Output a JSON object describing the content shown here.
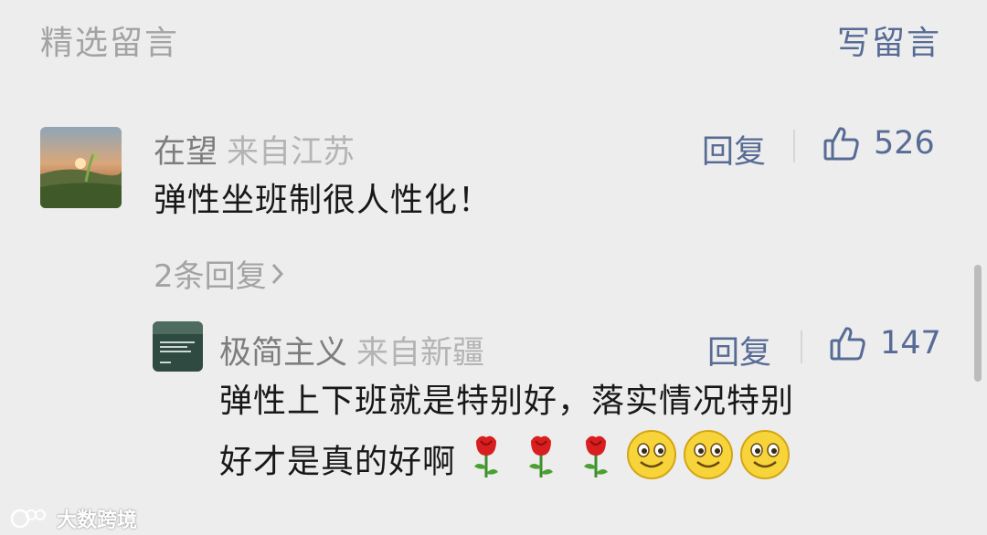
{
  "header": {
    "title": "精选留言",
    "write_label": "写留言"
  },
  "comments": [
    {
      "user": "在望",
      "location": "来自江苏",
      "text": "弹性坐班制很人性化！",
      "reply_label": "回复",
      "likes": "526",
      "more_replies": "2条回复"
    }
  ],
  "replies": [
    {
      "user": "极简主义",
      "location": "来自新疆",
      "text_line1": "弹性上下班就是特别好，落实情况特别",
      "text_line2": "好才是真的好啊",
      "emojis": [
        "rose-icon",
        "rose-icon",
        "rose-icon",
        "smile-icon",
        "smile-icon",
        "smile-icon"
      ],
      "reply_label": "回复",
      "likes": "147"
    }
  ],
  "watermark": "大数跨境",
  "colors": {
    "link": "#576b95",
    "muted": "#a3a3a3",
    "text": "#181818",
    "background": "#ededed"
  }
}
